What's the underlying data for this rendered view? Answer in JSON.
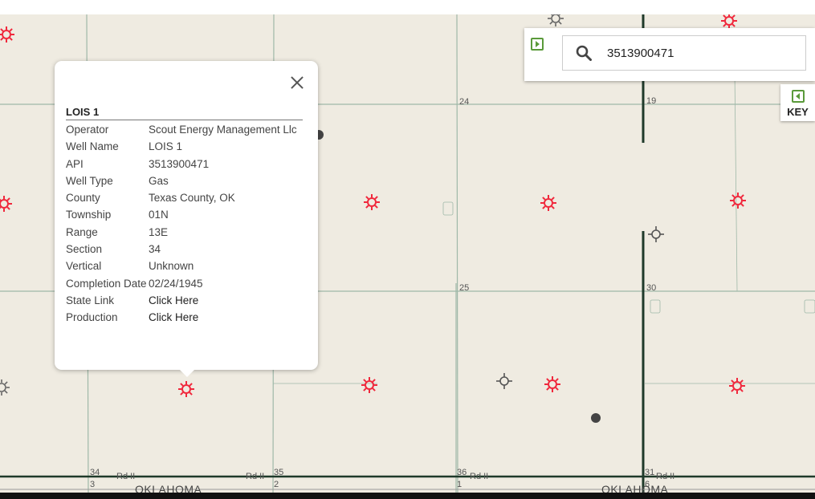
{
  "map": {
    "section_labels": [
      "24",
      "19",
      "25",
      "30",
      "34",
      "3",
      "35",
      "2",
      "36",
      "1",
      "31",
      "6"
    ],
    "road_labels": [
      "Rd II",
      "Rd II",
      "Rd II",
      "Rd II"
    ],
    "state_labels": [
      "OKLAHOMA",
      "OKLAHOMA"
    ],
    "colors": {
      "gas_well": "#f0283c",
      "other_well": "#555555",
      "background": "#efebe1"
    }
  },
  "popup": {
    "title": "LOIS 1",
    "rows": [
      {
        "label": "Operator",
        "value": "Scout Energy Management Llc"
      },
      {
        "label": "Well Name",
        "value": "LOIS 1"
      },
      {
        "label": "API",
        "value": "3513900471"
      },
      {
        "label": "Well Type",
        "value": "Gas"
      },
      {
        "label": "County",
        "value": "Texas County, OK"
      },
      {
        "label": "Township",
        "value": "01N"
      },
      {
        "label": "Range",
        "value": "13E"
      },
      {
        "label": "Section",
        "value": "34"
      },
      {
        "label": "Vertical",
        "value": "Unknown"
      },
      {
        "label": "Completion Date",
        "value": "02/24/1945"
      },
      {
        "label": "State Link",
        "value": "Click Here"
      },
      {
        "label": "Production",
        "value": "Click Here"
      }
    ]
  },
  "search": {
    "value": "3513900471",
    "icon": "search-icon"
  },
  "key": {
    "label": "KEY"
  }
}
